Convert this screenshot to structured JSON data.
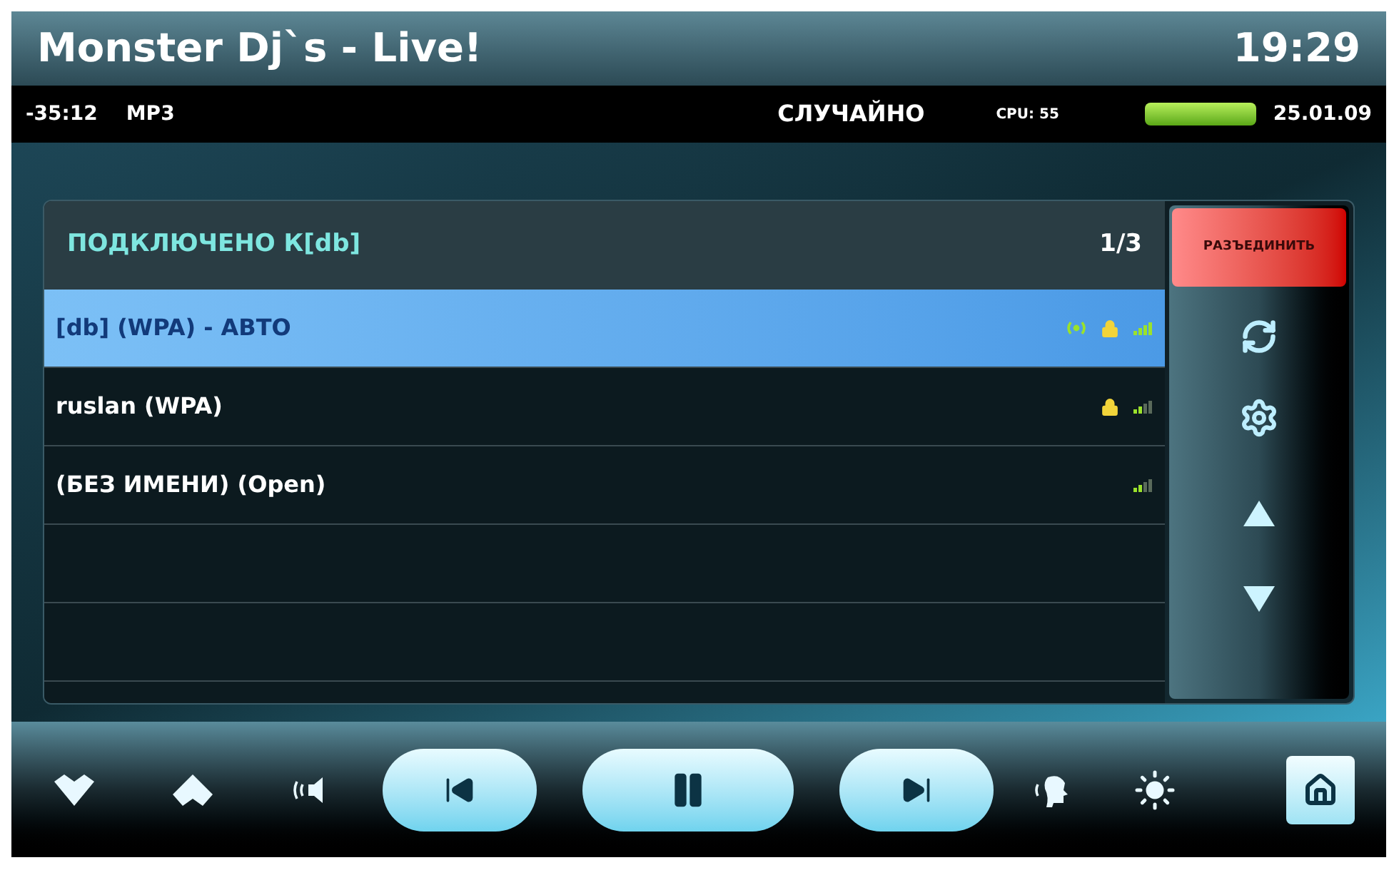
{
  "window": {
    "title": "Monster Dj`s - Live!",
    "clock": "19:29"
  },
  "status_bar": {
    "time_left": "-35:12",
    "format": "MP3",
    "mode": "СЛУЧАЙНО",
    "cpu": "CPU: 55",
    "date": "25.01.09"
  },
  "panel": {
    "title": "ПОДКЛЮЧЕНО К[db]",
    "page": "1/3",
    "networks": [
      {
        "name": "[db] (WPA) - АВТО",
        "selected": true,
        "connected": true,
        "secured": true,
        "strong_signal": true
      },
      {
        "name": "ruslan (WPA)",
        "selected": false,
        "connected": false,
        "secured": true,
        "strong_signal": false
      },
      {
        "name": "(БЕЗ ИМЕНИ) (Open)",
        "selected": false,
        "connected": false,
        "secured": false,
        "strong_signal": false
      }
    ],
    "disconnect_button": "РАЗЪЕДИНИТЬ"
  }
}
